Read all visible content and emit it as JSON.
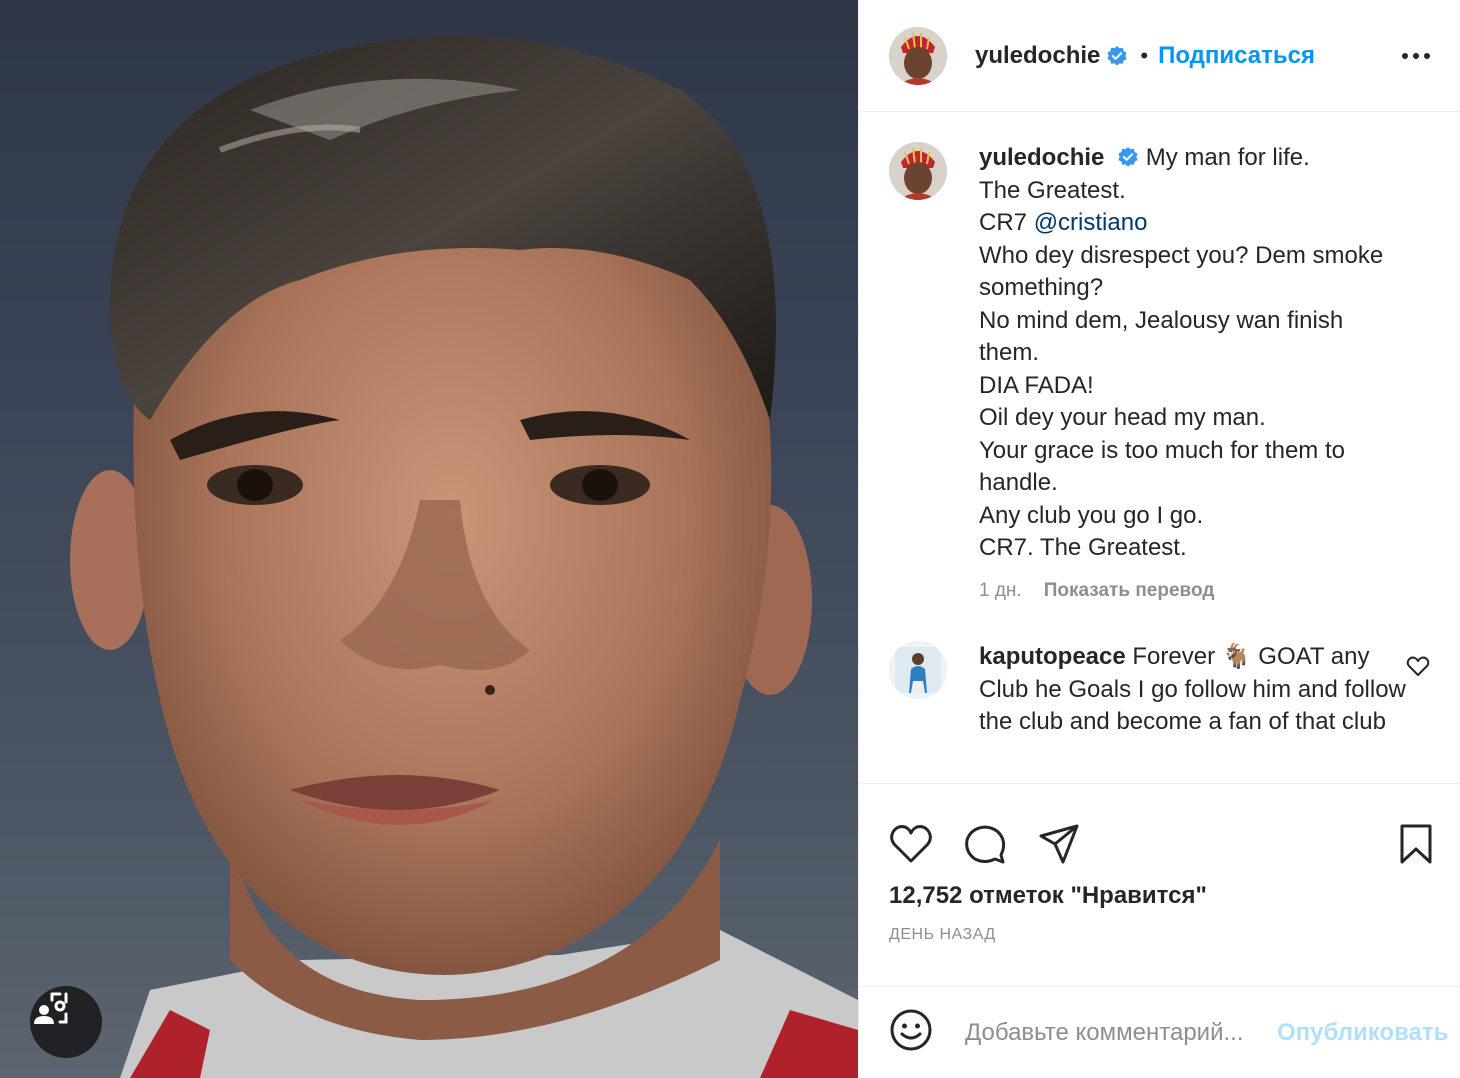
{
  "header": {
    "username": "yuledochie",
    "separator": "•",
    "follow_label": "Подписаться",
    "more_icon": "more-horizontal-icon"
  },
  "caption": {
    "username": "yuledochie",
    "lines": [
      "My man for life.",
      "The Greatest.",
      "CR7 ",
      "Who dey disrespect you? Dem smoke something?",
      "No mind dem, Jealousy wan finish them.",
      "DIA FADA!",
      "Oil dey your head my man.",
      "Your grace is too much for them to handle.",
      "Any club you go I go.",
      "CR7. The Greatest."
    ],
    "mention": "@cristiano",
    "time": "1 дн.",
    "translate_label": "Показать перевод"
  },
  "comments": [
    {
      "username": "kaputopeace",
      "text": "Forever 🐐 GOAT any Club he Goals I go follow him and follow the club and become a fan of that club"
    }
  ],
  "actions": {
    "like_icon": "heart-icon",
    "comment_icon": "comment-bubble-icon",
    "share_icon": "paper-plane-icon",
    "save_icon": "bookmark-icon"
  },
  "likes_text": "12,752 отметок \"Нравится\"",
  "time_ago": "День назад",
  "add_comment": {
    "placeholder": "Добавьте комментарий...",
    "publish_label": "Опубликовать"
  },
  "colors": {
    "accent": "#0095f6",
    "publish_disabled": "#b2dffc",
    "verified": "#3897f0",
    "text": "#262626",
    "muted": "#8e8e8e"
  }
}
